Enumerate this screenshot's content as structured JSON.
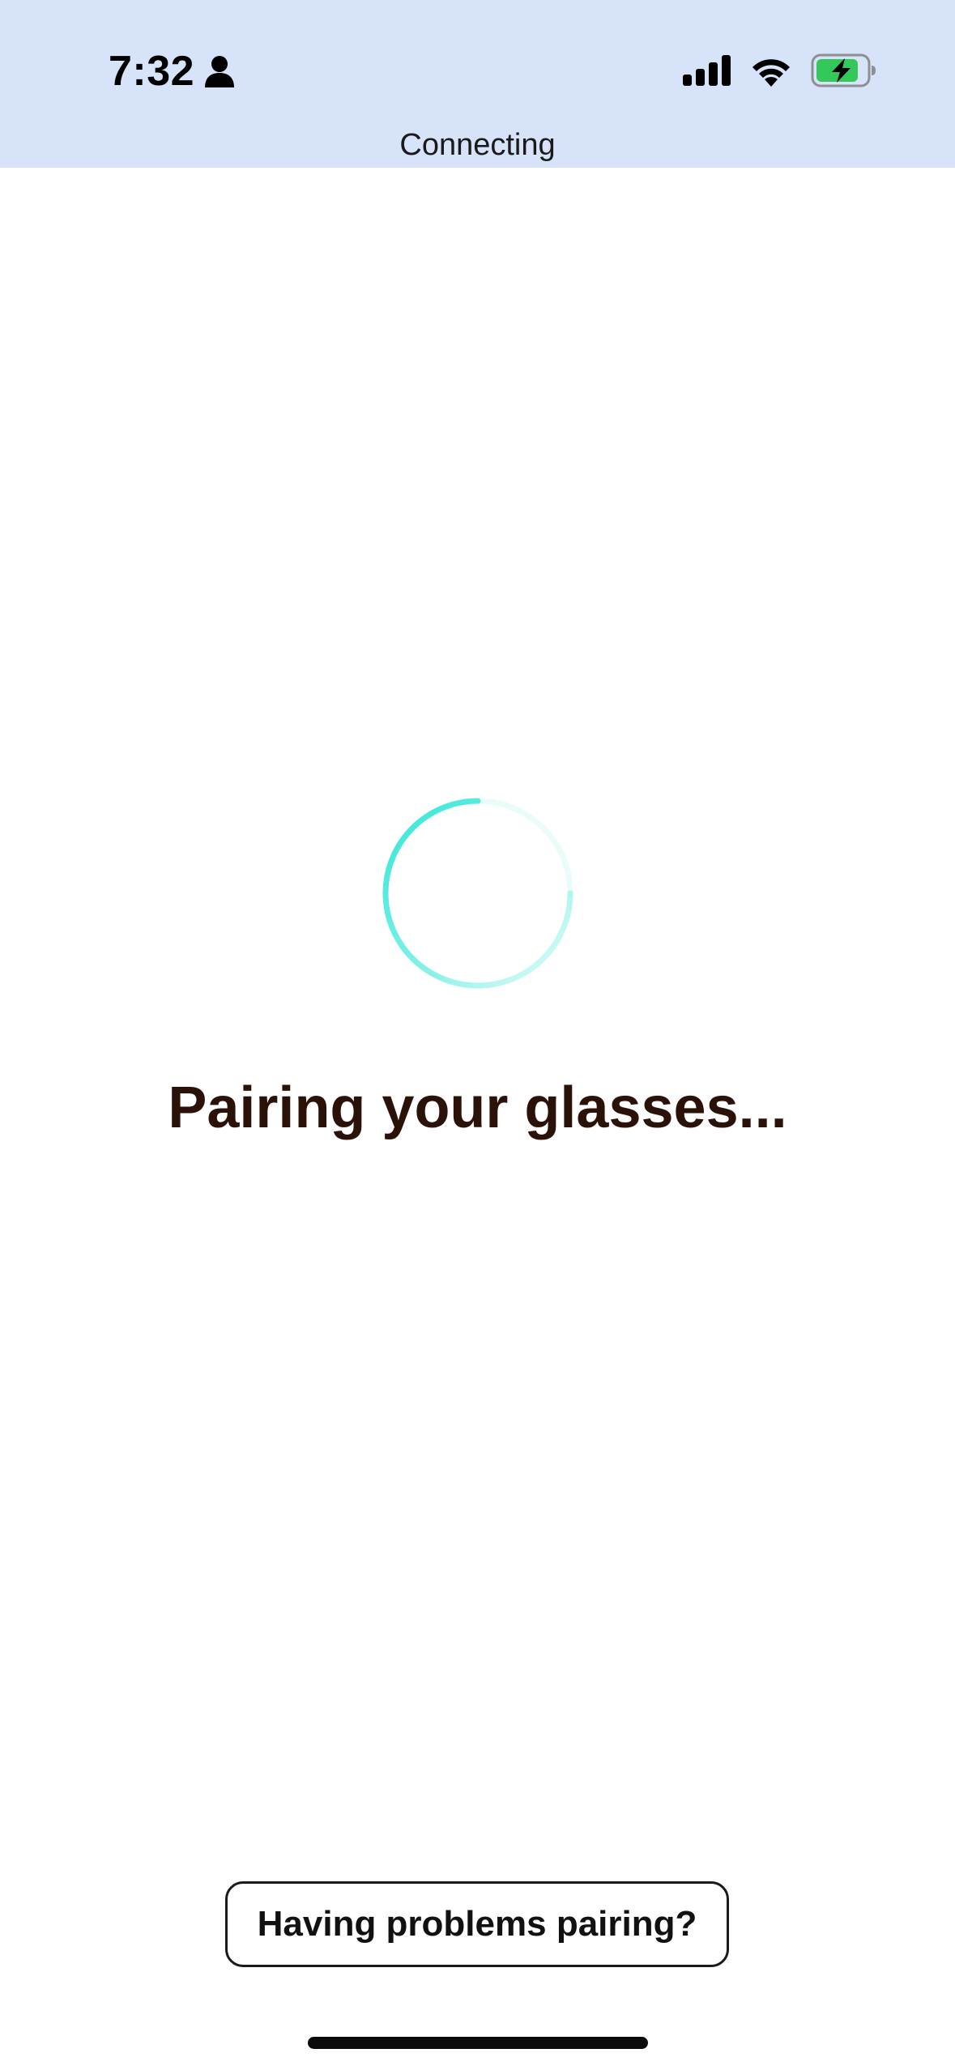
{
  "status_bar": {
    "time": "7:32",
    "person_icon": "person-icon",
    "signal_icon": "cellular-signal-icon",
    "wifi_icon": "wifi-icon",
    "battery_icon": "battery-charging-icon",
    "battery_level": 0.85,
    "background_color": "#d6e3f8",
    "battery_fill_color": "#34c759"
  },
  "header": {
    "label": "Connecting"
  },
  "spinner": {
    "icon": "loading-spinner-icon",
    "accent_color": "#2ee6d6"
  },
  "main": {
    "title": "Pairing your glasses..."
  },
  "footer": {
    "help_button_label": "Having problems pairing?"
  }
}
